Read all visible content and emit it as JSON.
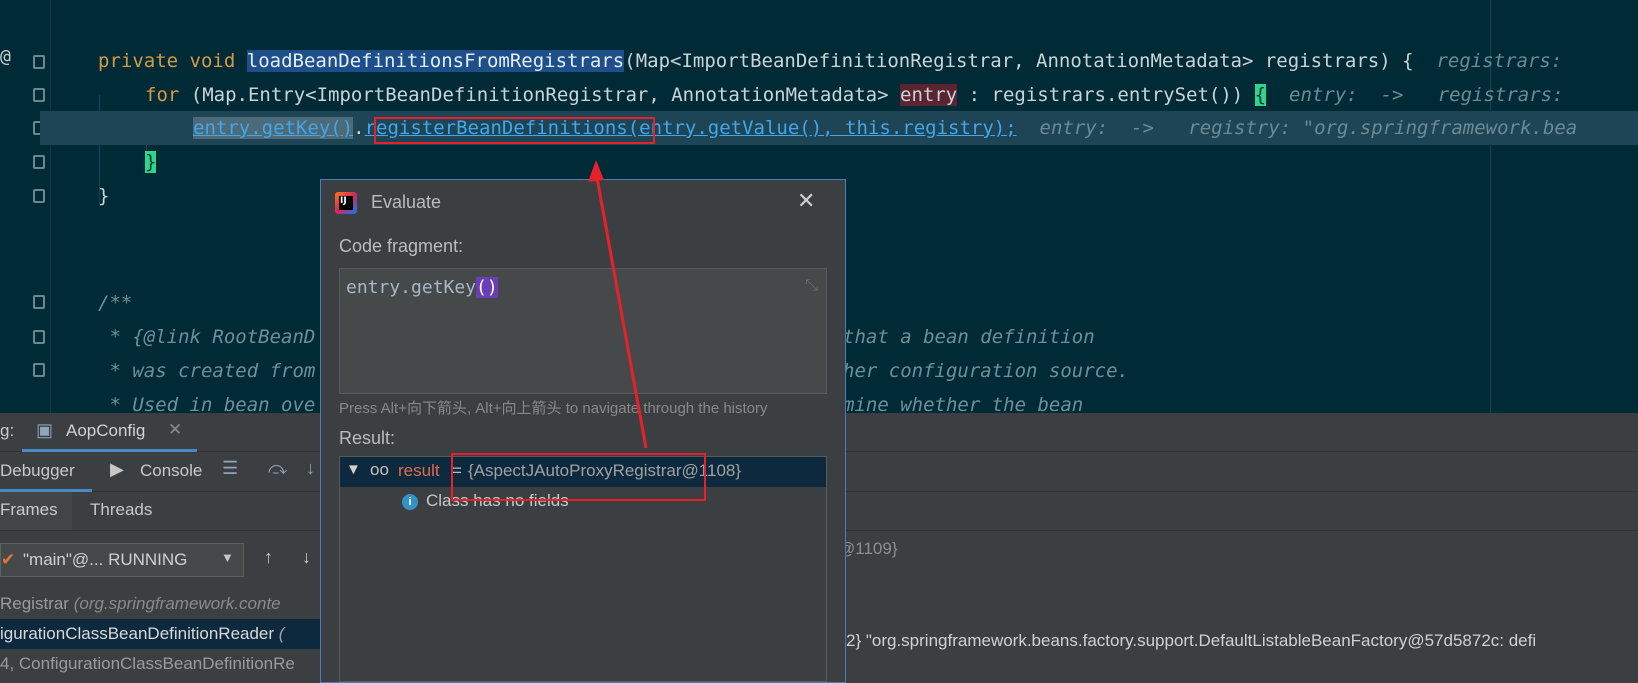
{
  "editor": {
    "at_symbol": "@",
    "line1": {
      "kw1": "private",
      "kw2": "void",
      "method": "loadBeanDefinitionsFromRegistrars",
      "params": "(Map<ImportBeanDefinitionRegistrar, AnnotationMetadata> registrars) {",
      "hint": "registrars:"
    },
    "line2": {
      "kw": "for",
      "part1": "(Map.Entry<ImportBeanDefinitionRegistrar, AnnotationMetadata>",
      "var": "entry",
      "part2": ": registrars.entrySet())",
      "brace": "{",
      "hint1": "entry:  ->",
      "hint2": "registrars:"
    },
    "line3": {
      "getkey": "entry.getKey()",
      "dot": ".",
      "call": "registerBeanDefinitions",
      "args": "(entry.getValue(), this.registry);",
      "hint1": "entry:  ->",
      "hint2": "registry: \"org.springframework.bea"
    },
    "line4": {
      "brace": "}"
    },
    "line5": {
      "brace": "}"
    },
    "comment": [
      "/**",
      " * {@link RootBeanD",
      " * was created from",
      " * Used in bean ove"
    ],
    "comment_right": [
      "that a bean definition",
      "her configuration source.",
      "mine whether the bean"
    ]
  },
  "debug": {
    "prefix_label": "g:",
    "run_tab": "AopConfig",
    "tabs": {
      "debugger": "Debugger",
      "console": "Console"
    },
    "subtabs": {
      "frames": "Frames",
      "threads": "Threads"
    },
    "thread_combo": "\"main\"@... RUNNING",
    "frames": [
      {
        "text": "Registrar",
        "pkg": "(org.springframework.conte"
      },
      {
        "text": "igurationClassBeanDefinitionReader",
        "pkg": "("
      },
      {
        "text": "4, ConfigurationClassBeanDefinitionRe",
        "pkg": ""
      }
    ],
    "variables_right": [
      "@1109}",
      "2} \"org.springframework.beans.factory.support.DefaultListableBeanFactory@57d5872c: defi"
    ]
  },
  "evaluate": {
    "title": "Evaluate",
    "code_fragment_label": "Code fragment:",
    "code_text": "entry.getKey",
    "code_parens": "()",
    "hint": "Press Alt+向下箭头, Alt+向上箭头 to navigate through the history",
    "result_label": "Result:",
    "result_name": "result",
    "result_eq": "=",
    "result_value": "{AspectJAutoProxyRegistrar@1108}",
    "no_fields": "Class has no fields"
  },
  "colors": {
    "editor_bg": "#002b36",
    "annotation_red": "#e8202b",
    "selection_blue": "#1f4f8a"
  }
}
